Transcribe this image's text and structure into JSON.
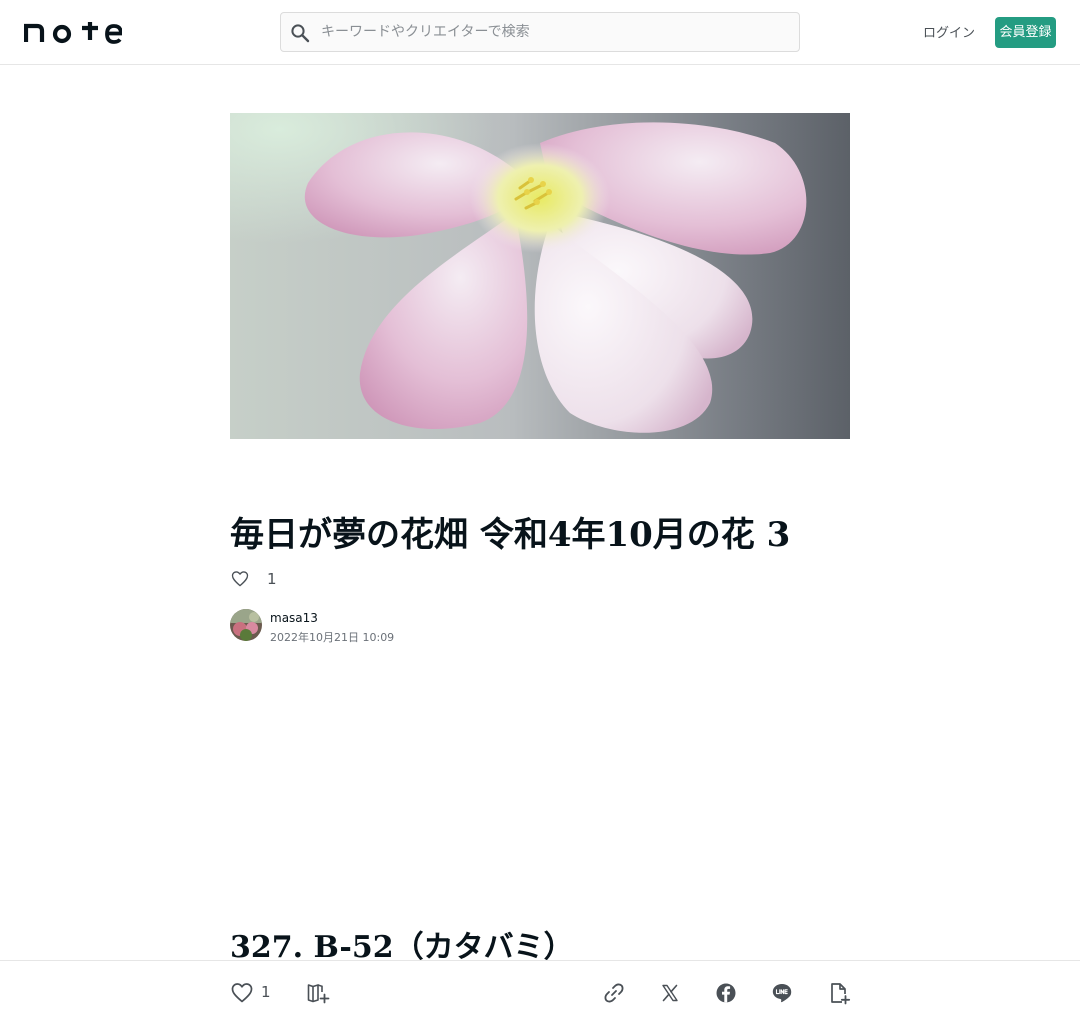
{
  "header": {
    "logo_text": "note",
    "search_placeholder": "キーワードやクリエイターで検索",
    "login_label": "ログイン",
    "signup_label": "会員登録",
    "accent_color": "#249c82"
  },
  "article": {
    "title": "毎日が夢の花畑 令和4年10月の花 3",
    "like_count": "1",
    "author_name": "masa13",
    "posted_at": "2022年10月21日 10:09",
    "section_heading": "327. B-52（カタバミ）"
  },
  "action_bar": {
    "like_count": "1",
    "icons": [
      "heart-icon",
      "magazine-add-icon",
      "link-icon",
      "x-icon",
      "facebook-icon",
      "line-icon",
      "note-embed-icon"
    ]
  }
}
